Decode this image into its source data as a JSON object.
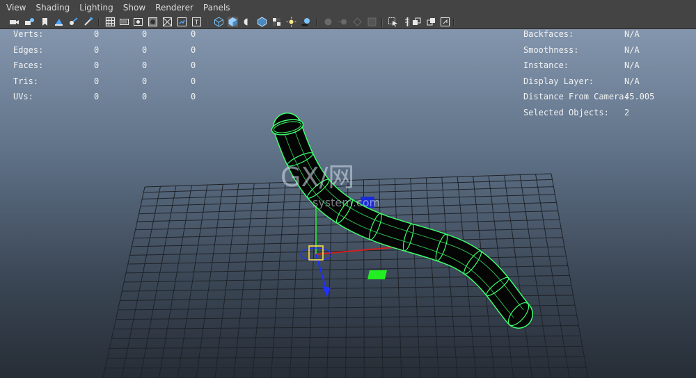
{
  "menubar": {
    "items": [
      "View",
      "Shading",
      "Lighting",
      "Show",
      "Renderer",
      "Panels"
    ]
  },
  "toolbar": {
    "icons": [
      "camera-icon",
      "camera-attributes-icon",
      "bookmark-icon",
      "image-plane-icon",
      "grease-pencil-icon",
      "2d-pan-zoom-icon",
      "grid-icon",
      "film-gate-icon",
      "resolution-gate-icon",
      "gate-mask-icon",
      "field-chart-icon",
      "safe-action-icon",
      "safe-title-icon",
      "wireframe-icon",
      "smooth-shade-icon",
      "default-material-icon",
      "shaded-wireframe-icon",
      "textured-icon",
      "use-all-lights-icon",
      "shadows-icon",
      "screen-space-ao-icon",
      "motion-blur-icon",
      "anti-aliasing-icon",
      "depth-of-field-icon",
      "isolate-select-icon",
      "xray-icon",
      "xray-joints-icon",
      "single-view-icon",
      "two-pane-icon",
      "four-pane-icon"
    ]
  },
  "hud_left": {
    "rows": [
      {
        "label": "Verts:",
        "values": [
          "0",
          "0",
          "0"
        ]
      },
      {
        "label": "Edges:",
        "values": [
          "0",
          "0",
          "0"
        ]
      },
      {
        "label": "Faces:",
        "values": [
          "0",
          "0",
          "0"
        ]
      },
      {
        "label": "Tris:",
        "values": [
          "0",
          "0",
          "0"
        ]
      },
      {
        "label": "UVs:",
        "values": [
          "0",
          "0",
          "0"
        ]
      }
    ]
  },
  "hud_right": {
    "rows": [
      {
        "label": "Backfaces:",
        "value": "N/A"
      },
      {
        "label": "Smoothness:",
        "value": "N/A"
      },
      {
        "label": "Instance:",
        "value": "N/A"
      },
      {
        "label": "Display Layer:",
        "value": "N/A"
      },
      {
        "label": "Distance From Camera:",
        "value": "45.005"
      },
      {
        "label": "Selected Objects:",
        "value": "2"
      }
    ]
  },
  "watermark": {
    "main": "GX/网",
    "sub": "system.com"
  },
  "colors": {
    "wireframe": "#3cff6e",
    "grid": "#1e2228",
    "menubar_bg": "#444444",
    "axis_y": "#2ecc40",
    "axis_x": "#d02020",
    "axis_z": "#2030ff",
    "pivot": "#ffe04a"
  }
}
